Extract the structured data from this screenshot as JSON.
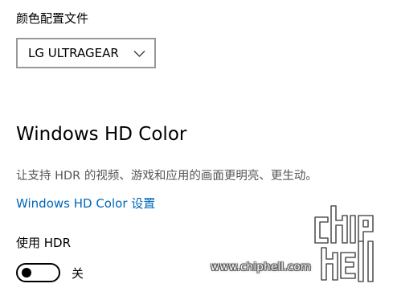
{
  "profile": {
    "label": "颜色配置文件",
    "selected": "LG ULTRAGEAR",
    "icon": "chevron-down-icon"
  },
  "hd_color": {
    "title": "Windows HD Color",
    "description": "让支持 HDR 的视频、游戏和应用的画面更明亮、更生动。",
    "settings_link": "Windows HD Color 设置",
    "link_color": "#0067b8"
  },
  "hdr": {
    "label": "使用 HDR",
    "toggle_state": "关",
    "toggle_on": false
  },
  "watermark": {
    "url": "www.chiphell.com",
    "logo_text": "chiphell"
  }
}
